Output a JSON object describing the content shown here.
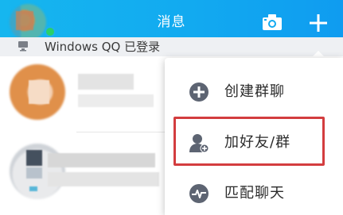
{
  "header": {
    "title": "消息",
    "background_color": "#12aaf0",
    "status_dot_color": "#2ad06a",
    "camera_icon": "camera-icon",
    "plus_icon": "plus-icon"
  },
  "notice": {
    "text": "Windows QQ 已登录",
    "icon": "computer-icon"
  },
  "menu": {
    "items": [
      {
        "label": "创建群聊",
        "icon": "add-circle-icon"
      },
      {
        "label": "加好友/群",
        "icon": "add-friend-icon"
      },
      {
        "label": "匹配聊天",
        "icon": "match-chat-icon"
      }
    ],
    "highlight_color": "#d33d3f"
  }
}
